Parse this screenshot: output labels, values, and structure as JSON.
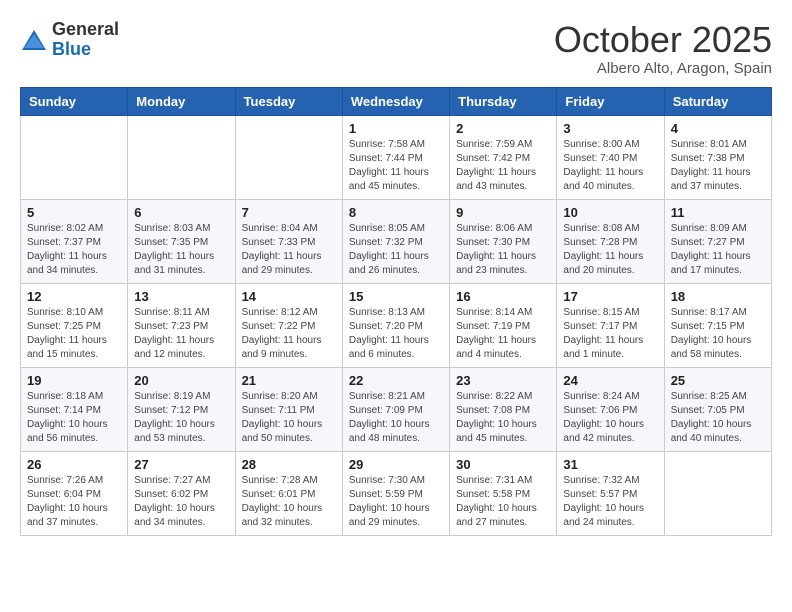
{
  "logo": {
    "line1": "General",
    "line2": "Blue"
  },
  "title": "October 2025",
  "subtitle": "Albero Alto, Aragon, Spain",
  "weekdays": [
    "Sunday",
    "Monday",
    "Tuesday",
    "Wednesday",
    "Thursday",
    "Friday",
    "Saturday"
  ],
  "weeks": [
    [
      {
        "day": "",
        "info": ""
      },
      {
        "day": "",
        "info": ""
      },
      {
        "day": "",
        "info": ""
      },
      {
        "day": "1",
        "info": "Sunrise: 7:58 AM\nSunset: 7:44 PM\nDaylight: 11 hours\nand 45 minutes."
      },
      {
        "day": "2",
        "info": "Sunrise: 7:59 AM\nSunset: 7:42 PM\nDaylight: 11 hours\nand 43 minutes."
      },
      {
        "day": "3",
        "info": "Sunrise: 8:00 AM\nSunset: 7:40 PM\nDaylight: 11 hours\nand 40 minutes."
      },
      {
        "day": "4",
        "info": "Sunrise: 8:01 AM\nSunset: 7:38 PM\nDaylight: 11 hours\nand 37 minutes."
      }
    ],
    [
      {
        "day": "5",
        "info": "Sunrise: 8:02 AM\nSunset: 7:37 PM\nDaylight: 11 hours\nand 34 minutes."
      },
      {
        "day": "6",
        "info": "Sunrise: 8:03 AM\nSunset: 7:35 PM\nDaylight: 11 hours\nand 31 minutes."
      },
      {
        "day": "7",
        "info": "Sunrise: 8:04 AM\nSunset: 7:33 PM\nDaylight: 11 hours\nand 29 minutes."
      },
      {
        "day": "8",
        "info": "Sunrise: 8:05 AM\nSunset: 7:32 PM\nDaylight: 11 hours\nand 26 minutes."
      },
      {
        "day": "9",
        "info": "Sunrise: 8:06 AM\nSunset: 7:30 PM\nDaylight: 11 hours\nand 23 minutes."
      },
      {
        "day": "10",
        "info": "Sunrise: 8:08 AM\nSunset: 7:28 PM\nDaylight: 11 hours\nand 20 minutes."
      },
      {
        "day": "11",
        "info": "Sunrise: 8:09 AM\nSunset: 7:27 PM\nDaylight: 11 hours\nand 17 minutes."
      }
    ],
    [
      {
        "day": "12",
        "info": "Sunrise: 8:10 AM\nSunset: 7:25 PM\nDaylight: 11 hours\nand 15 minutes."
      },
      {
        "day": "13",
        "info": "Sunrise: 8:11 AM\nSunset: 7:23 PM\nDaylight: 11 hours\nand 12 minutes."
      },
      {
        "day": "14",
        "info": "Sunrise: 8:12 AM\nSunset: 7:22 PM\nDaylight: 11 hours\nand 9 minutes."
      },
      {
        "day": "15",
        "info": "Sunrise: 8:13 AM\nSunset: 7:20 PM\nDaylight: 11 hours\nand 6 minutes."
      },
      {
        "day": "16",
        "info": "Sunrise: 8:14 AM\nSunset: 7:19 PM\nDaylight: 11 hours\nand 4 minutes."
      },
      {
        "day": "17",
        "info": "Sunrise: 8:15 AM\nSunset: 7:17 PM\nDaylight: 11 hours\nand 1 minute."
      },
      {
        "day": "18",
        "info": "Sunrise: 8:17 AM\nSunset: 7:15 PM\nDaylight: 10 hours\nand 58 minutes."
      }
    ],
    [
      {
        "day": "19",
        "info": "Sunrise: 8:18 AM\nSunset: 7:14 PM\nDaylight: 10 hours\nand 56 minutes."
      },
      {
        "day": "20",
        "info": "Sunrise: 8:19 AM\nSunset: 7:12 PM\nDaylight: 10 hours\nand 53 minutes."
      },
      {
        "day": "21",
        "info": "Sunrise: 8:20 AM\nSunset: 7:11 PM\nDaylight: 10 hours\nand 50 minutes."
      },
      {
        "day": "22",
        "info": "Sunrise: 8:21 AM\nSunset: 7:09 PM\nDaylight: 10 hours\nand 48 minutes."
      },
      {
        "day": "23",
        "info": "Sunrise: 8:22 AM\nSunset: 7:08 PM\nDaylight: 10 hours\nand 45 minutes."
      },
      {
        "day": "24",
        "info": "Sunrise: 8:24 AM\nSunset: 7:06 PM\nDaylight: 10 hours\nand 42 minutes."
      },
      {
        "day": "25",
        "info": "Sunrise: 8:25 AM\nSunset: 7:05 PM\nDaylight: 10 hours\nand 40 minutes."
      }
    ],
    [
      {
        "day": "26",
        "info": "Sunrise: 7:26 AM\nSunset: 6:04 PM\nDaylight: 10 hours\nand 37 minutes."
      },
      {
        "day": "27",
        "info": "Sunrise: 7:27 AM\nSunset: 6:02 PM\nDaylight: 10 hours\nand 34 minutes."
      },
      {
        "day": "28",
        "info": "Sunrise: 7:28 AM\nSunset: 6:01 PM\nDaylight: 10 hours\nand 32 minutes."
      },
      {
        "day": "29",
        "info": "Sunrise: 7:30 AM\nSunset: 5:59 PM\nDaylight: 10 hours\nand 29 minutes."
      },
      {
        "day": "30",
        "info": "Sunrise: 7:31 AM\nSunset: 5:58 PM\nDaylight: 10 hours\nand 27 minutes."
      },
      {
        "day": "31",
        "info": "Sunrise: 7:32 AM\nSunset: 5:57 PM\nDaylight: 10 hours\nand 24 minutes."
      },
      {
        "day": "",
        "info": ""
      }
    ]
  ]
}
